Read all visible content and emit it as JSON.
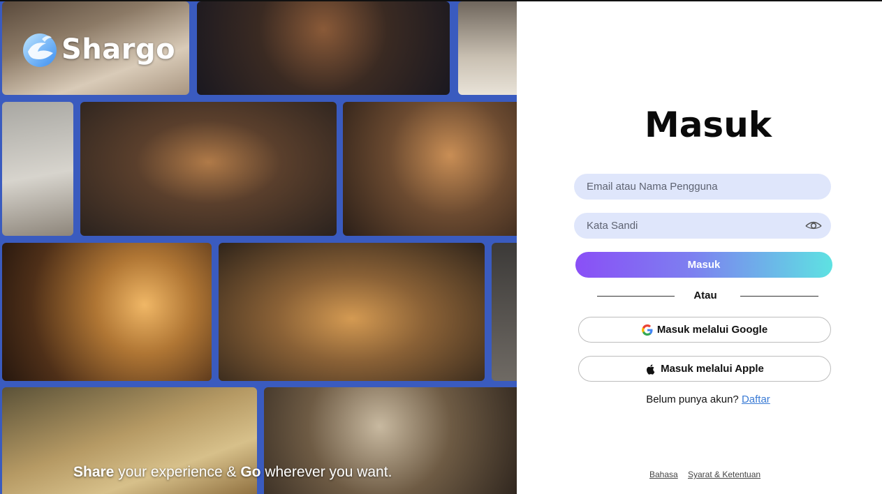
{
  "brand": {
    "name": "Shargo"
  },
  "hero": {
    "tagline_word1": "Share",
    "tagline_mid": " your experience & ",
    "tagline_word2": "Go",
    "tagline_end": " wherever you want."
  },
  "form": {
    "title": "Masuk",
    "email_placeholder": "Email atau Nama Pengguna",
    "password_placeholder": "Kata Sandi",
    "submit_label": "Masuk",
    "divider_text": "Atau",
    "google_label": "Masuk melalui Google",
    "apple_label": "Masuk melalui Apple",
    "signup_prompt": "Belum punya akun? ",
    "signup_link": "Daftar"
  },
  "footer": {
    "language_link": "Bahasa",
    "terms_link": "Syarat & Ketentuan"
  },
  "colors": {
    "accent_gradient_start": "#8a4ff6",
    "accent_gradient_end": "#5ee2e2",
    "input_bg": "#dfe6fb",
    "collage_bg": "#3a5bbf",
    "link": "#3a7bd5"
  },
  "icons": [
    "eye-icon",
    "google-icon",
    "apple-icon",
    "shargo-logo-icon"
  ]
}
